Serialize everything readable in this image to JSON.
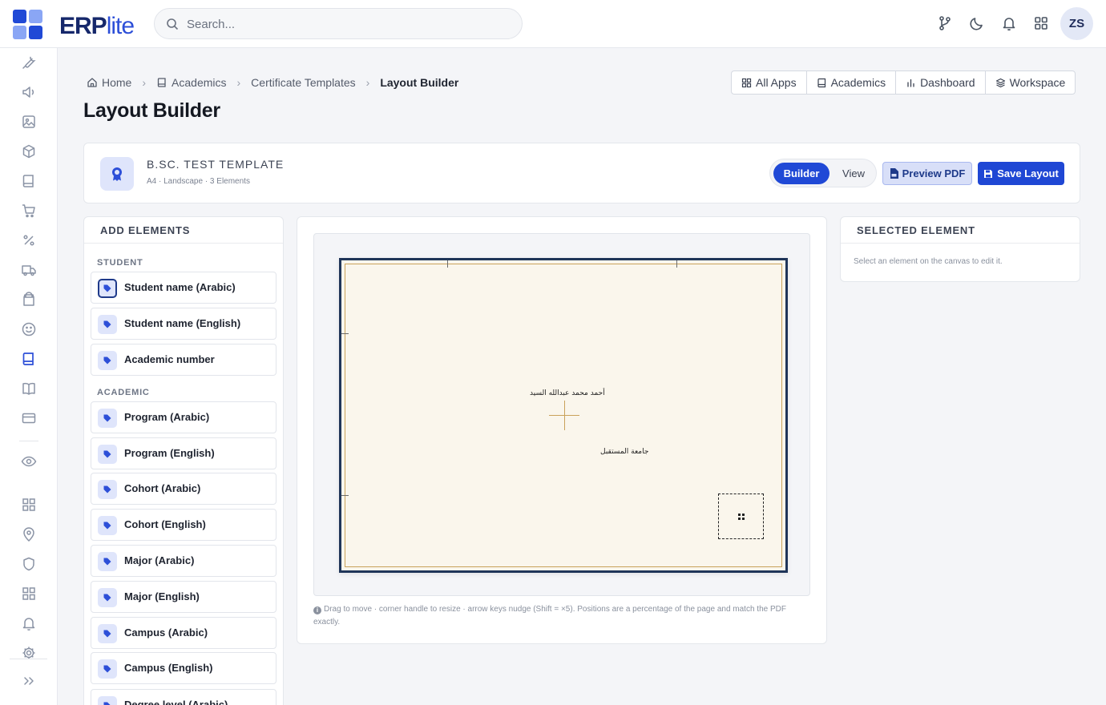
{
  "app": {
    "brand_main": "ERP",
    "brand_accent": "lite",
    "brand_color": "#16286b",
    "accent_color": "#2d4fd8"
  },
  "search": {
    "placeholder": "Search..."
  },
  "topbar": {
    "icons": [
      "git-branch-icon",
      "moon-icon",
      "bell-icon",
      "apps-grid-icon"
    ],
    "avatar_initials": "ZS"
  },
  "rail": {
    "icons": [
      "tools-icon",
      "megaphone-icon",
      "image-icon",
      "cube-icon",
      "book-icon",
      "cart-icon",
      "percent-icon",
      "truck-icon",
      "store-icon",
      "smile-icon",
      "academics-book-icon",
      "open-book-icon",
      "credit-card-icon",
      "eye-icon",
      "grid-icon",
      "map-pin-icon",
      "shield-icon",
      "grid-alt-icon",
      "bell-icon",
      "settings-icon",
      "expand-icon"
    ],
    "active": "academics-book-icon"
  },
  "breadcrumb": {
    "items": [
      "Home",
      "Academics",
      "Certificate Templates",
      "Layout Builder"
    ]
  },
  "page": {
    "title": "Layout Builder"
  },
  "quick_links": [
    "All Apps",
    "Academics",
    "Dashboard",
    "Workspace"
  ],
  "template": {
    "name": "B.SC. TEST TEMPLATE",
    "meta": "A4 · Landscape · 3 Elements",
    "mode_builder": "Builder",
    "mode_view": "View",
    "active_mode": "Builder",
    "preview_label": "Preview PDF",
    "save_label": "Save Layout"
  },
  "add_elements": {
    "title": "ADD ELEMENTS",
    "groups": [
      {
        "label": "STUDENT",
        "items": [
          "Student name (Arabic)",
          "Student name (English)",
          "Academic number"
        ]
      },
      {
        "label": "ACADEMIC",
        "items": [
          "Program (Arabic)",
          "Program (English)",
          "Cohort (Arabic)",
          "Cohort (English)",
          "Major (Arabic)",
          "Major (English)",
          "Campus (Arabic)",
          "Campus (English)",
          "Degree level (Arabic)"
        ]
      }
    ]
  },
  "canvas": {
    "student_name_ar": "أحمد محمد عبدالله السيد",
    "university_ar": "جامعة المستقبل",
    "page_bg": "#faf6ec",
    "border_color": "#1f3559",
    "gold_color": "#c9a25a",
    "hint": "Drag to move · corner handle to resize · arrow keys nudge (Shift = ×5). Positions are a percentage of the page and match the PDF exactly."
  },
  "selected_element": {
    "title": "SELECTED ELEMENT",
    "empty_text": "Select an element on the canvas to edit it."
  }
}
